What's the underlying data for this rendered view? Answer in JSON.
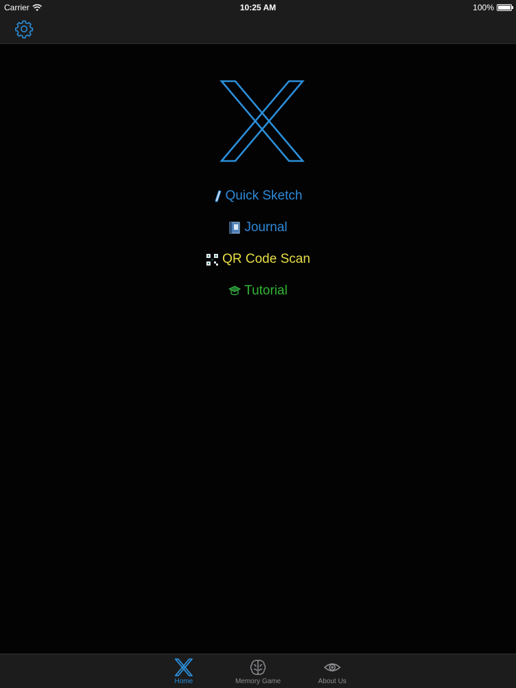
{
  "status_bar": {
    "carrier": "Carrier",
    "time": "10:25 AM",
    "battery_text": "100%",
    "battery_level": 1.0
  },
  "nav_bar": {
    "settings_icon": "gear-icon"
  },
  "logo": {
    "icon": "x-logo-icon"
  },
  "menu": {
    "items": [
      {
        "label": "Quick Sketch",
        "icon": "pencil-icon",
        "color": "#2d8ad8"
      },
      {
        "label": "Journal",
        "icon": "notebook-icon",
        "color": "#2d8ad8"
      },
      {
        "label": "QR Code Scan",
        "icon": "qr-code-icon",
        "color": "#e8de45"
      },
      {
        "label": "Tutorial",
        "icon": "graduation-cap-icon",
        "color": "#2fb634"
      }
    ]
  },
  "tab_bar": {
    "tabs": [
      {
        "label": "Home",
        "icon": "x-logo-icon",
        "selected": true
      },
      {
        "label": "Memory Game",
        "icon": "brain-icon",
        "selected": false
      },
      {
        "label": "About Us",
        "icon": "eye-icon",
        "selected": false
      }
    ]
  },
  "colors": {
    "accent": "#2b8ed9",
    "background": "#030303",
    "bar": "#1c1c1c",
    "tab_inactive": "#8e8e93"
  }
}
